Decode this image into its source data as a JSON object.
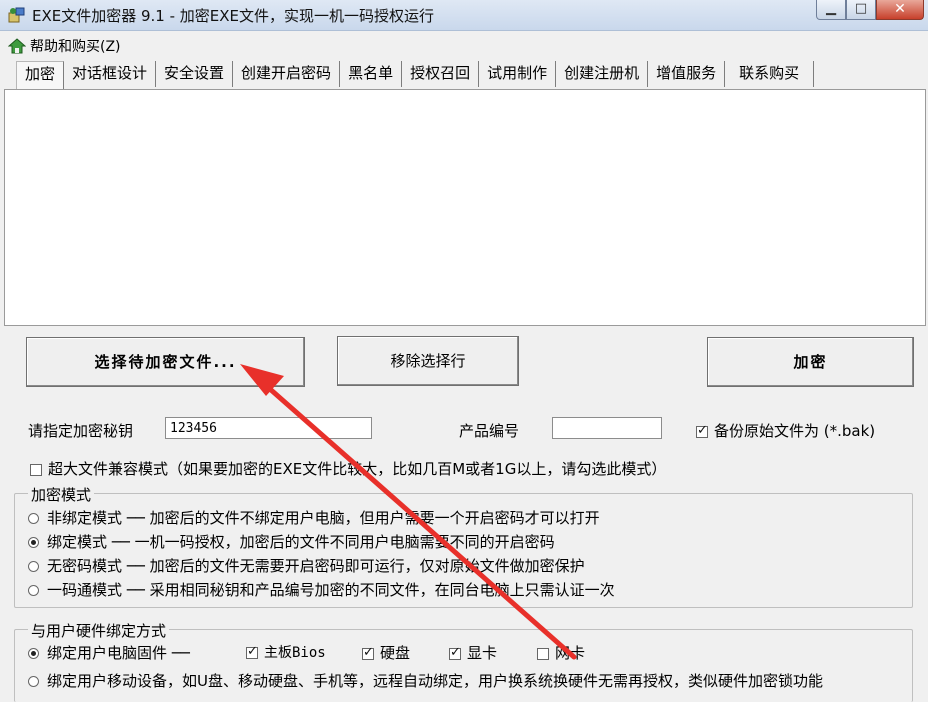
{
  "window": {
    "title": "EXE文件加密器 9.1 - 加密EXE文件，实现一机一码授权运行",
    "minimize_glyph": "▁",
    "maximize_glyph": "□",
    "close_glyph": "✕"
  },
  "menu": {
    "help": "帮助和购买(Z)"
  },
  "tabs": [
    "加密",
    "对话框设计",
    "安全设置",
    "创建开启密码",
    "黑名单",
    "授权召回",
    "试用制作",
    "创建注册机",
    "增值服务",
    "联系购买"
  ],
  "buttons": {
    "select_file": "选择待加密文件...",
    "remove_row": "移除选择行",
    "encrypt": "加密"
  },
  "key_row": {
    "key_label": "请指定加密秘钥",
    "key_value": "123456",
    "product_label": "产品编号",
    "product_value": "",
    "backup_label": "备份原始文件为 (*.bak)"
  },
  "large_file": {
    "label": "超大文件兼容模式（如果要加密的EXE文件比较大，比如几百M或者1G以上，请勾选此模式）"
  },
  "mode_group": {
    "title": "加密模式",
    "options": [
      "非绑定模式 ── 加密后的文件不绑定用户电脑，但用户需要一个开启密码才可以打开",
      "绑定模式 ── 一机一码授权，加密后的文件不同用户电脑需要不同的开启密码",
      "无密码模式 ── 加密后的文件无需要开启密码即可运行，仅对原始文件做加密保护",
      "一码通模式 ── 采用相同秘钥和产品编号加密的不同文件，在同台电脑上只需认证一次"
    ]
  },
  "bind_group": {
    "title": "与用户硬件绑定方式",
    "fixed_label": "绑定用户电脑固件 ──",
    "hw": [
      "主板Bios",
      "硬盘",
      "显卡",
      "网卡"
    ],
    "mobile_label": "绑定用户移动设备，如U盘、移动硬盘、手机等，远程自动绑定，用户换系统换硬件无需再授权，类似硬件加密锁功能"
  },
  "colors": {
    "arrow": "#e8302a",
    "title_bar": "#c9d8ec"
  }
}
